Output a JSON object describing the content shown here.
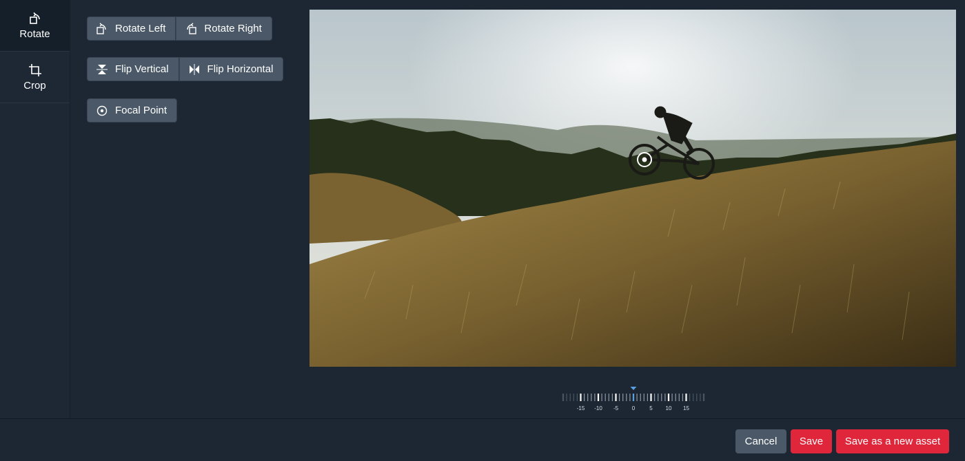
{
  "sidebar": {
    "tabs": [
      {
        "label": "Rotate",
        "icon": "rotate-icon",
        "active": true
      },
      {
        "label": "Crop",
        "icon": "crop-icon",
        "active": false
      }
    ]
  },
  "options": {
    "rotate_left": "Rotate Left",
    "rotate_right": "Rotate Right",
    "flip_vertical": "Flip Vertical",
    "flip_horizontal": "Flip Horizontal",
    "focal_point": "Focal Point"
  },
  "ruler": {
    "value": 0,
    "min": -20,
    "max": 20,
    "labels": [
      "-15",
      "-10",
      "-5",
      "0",
      "5",
      "10",
      "15"
    ],
    "accent": "#5a9fe0"
  },
  "footer": {
    "cancel": "Cancel",
    "save": "Save",
    "save_new": "Save as a new asset"
  },
  "colors": {
    "background": "#1d2733",
    "button": "#4a5867",
    "primary": "#e0263a"
  }
}
